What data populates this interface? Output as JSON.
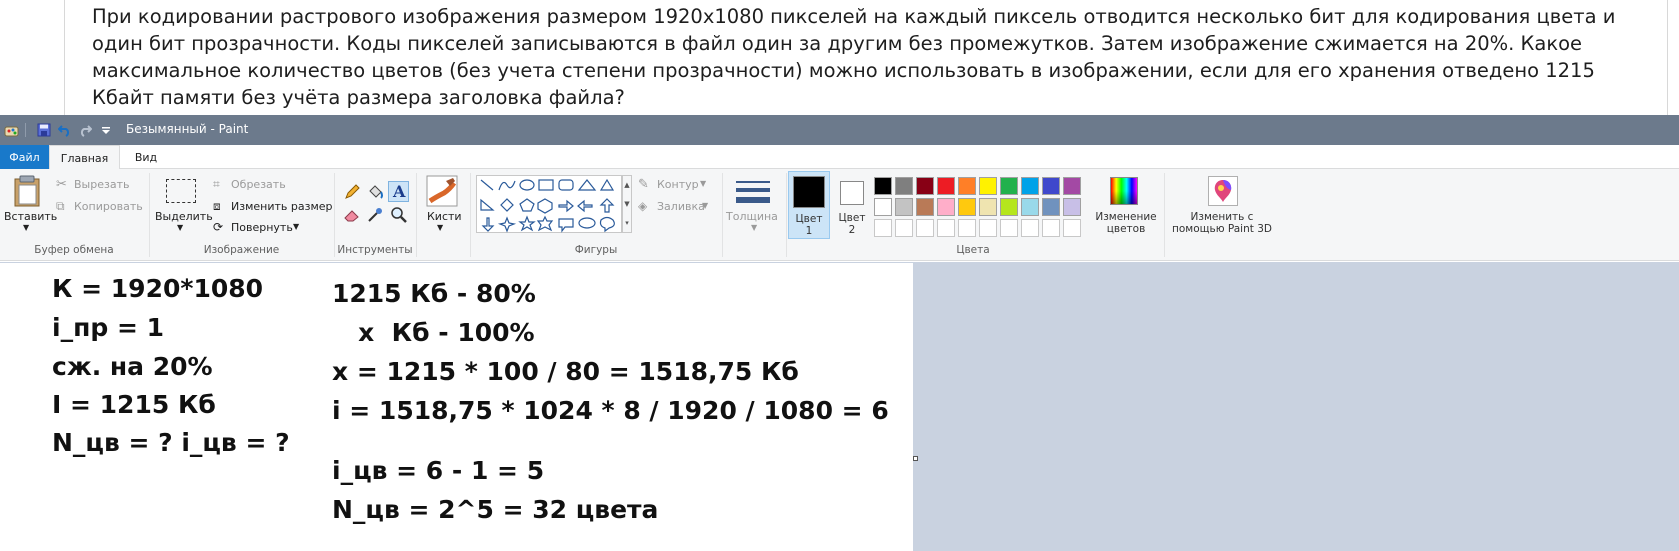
{
  "question": {
    "text": "При кодировании растрового изображения размером 1920x1080 пикселей на каждый пиксель отводится несколько бит для кодирования цвета и один бит прозрачности. Коды пикселей записываются в файл один за другим без промежутков. Затем изображение сжимается на 20%. Какое максимальное количество цветов (без учета степени прозрачности) можно использовать в изображении, если для его хранения отведено 1215 Кбайт памяти без учёта размера заголовка файла?"
  },
  "window": {
    "title": "Безымянный - Paint"
  },
  "tabs": {
    "file": "Файл",
    "home": "Главная",
    "view": "Вид"
  },
  "ribbon": {
    "clipboard": {
      "label": "Буфер обмена",
      "paste": "Вставить",
      "cut": "Вырезать",
      "copy": "Копировать"
    },
    "image": {
      "label": "Изображение",
      "select": "Выделить",
      "crop": "Обрезать",
      "resize": "Изменить размер",
      "rotate": "Повернуть"
    },
    "tools": {
      "label": "Инструменты"
    },
    "brushes": {
      "label": "Кисти"
    },
    "shapes": {
      "label": "Фигуры",
      "outline": "Контур",
      "fill": "Заливка"
    },
    "size": {
      "label": "Толщина"
    },
    "colors": {
      "label": "Цвета",
      "color1": "Цвет",
      "color1_num": "1",
      "color2": "Цвет",
      "color2_num": "2",
      "edit_colors_1": "Изменение",
      "edit_colors_2": "цветов",
      "color1_value": "#000000",
      "color2_value": "#ffffff",
      "palette_row1": [
        "#000000",
        "#7f7f7f",
        "#880015",
        "#ed1c24",
        "#ff7f27",
        "#fff200",
        "#22b14c",
        "#00a2e8",
        "#3f48cc",
        "#a349a4"
      ],
      "palette_row2": [
        "#ffffff",
        "#c3c3c3",
        "#b97a57",
        "#ffaec9",
        "#ffc90e",
        "#efe4b0",
        "#b5e61d",
        "#99d9ea",
        "#7092be",
        "#c8bfe7"
      ]
    },
    "paint3d": {
      "line1": "Изменить с",
      "line2": "помощью Paint 3D"
    }
  },
  "canvas": {
    "left": [
      "К = 1920*1080",
      "i_пр = 1",
      "сж. на 20%",
      "I = 1215 Кб",
      "N_цв = ? i_цв = ?"
    ],
    "right": [
      "1215 Кб - 80%",
      "   х  Кб - 100%",
      "x = 1215 * 100 / 80 = 1518,75 Кб",
      "i = 1518,75 * 1024 * 8 / 1920 / 1080 = 6",
      "i_цв = 6 - 1 = 5",
      "N_цв = 2^5 = 32 цвета"
    ]
  }
}
